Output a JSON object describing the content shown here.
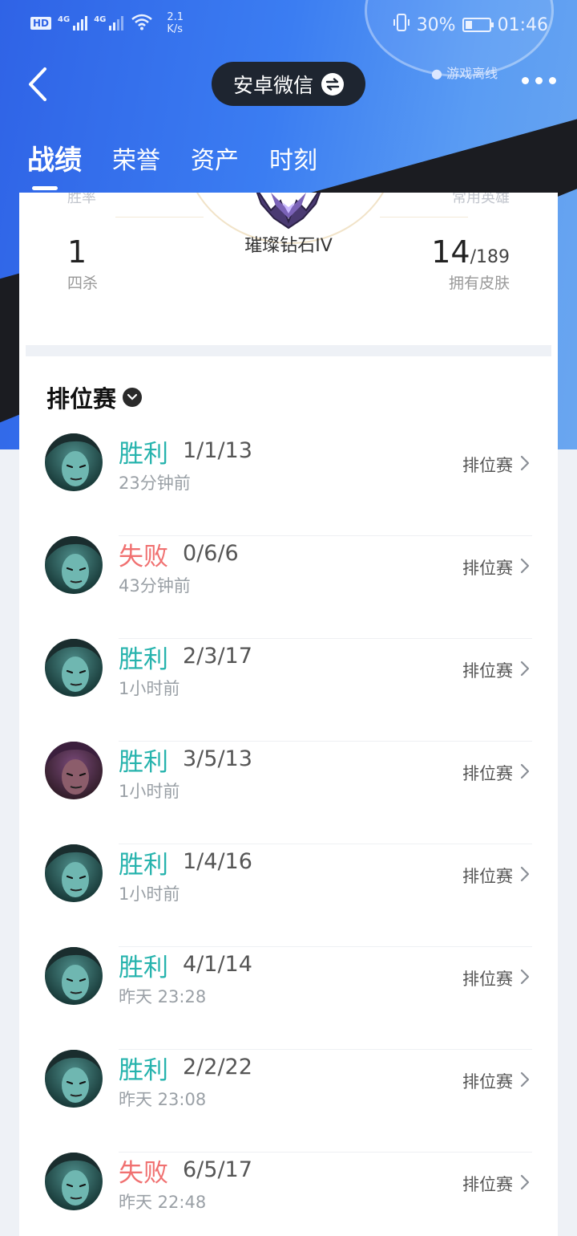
{
  "status_bar": {
    "hd": "HD",
    "net1": "4G",
    "net2": "4G",
    "speed_value": "2.1",
    "speed_unit": "K/s",
    "battery": "30%",
    "battery_level": 0.3,
    "time": "01:46"
  },
  "nav": {
    "account_label": "安卓微信",
    "game_status": "游戏离线"
  },
  "tabs": [
    {
      "label": "战绩",
      "active": true
    },
    {
      "label": "荣誉",
      "active": false
    },
    {
      "label": "资产",
      "active": false
    },
    {
      "label": "时刻",
      "active": false
    }
  ],
  "stats": {
    "rank_name": "璀璨钻石IV",
    "quadra_kills_value": "1",
    "quadra_kills_label": "四杀",
    "skins_owned": "14",
    "skins_total": "/189",
    "skins_label": "拥有皮肤",
    "cut_label_left": "胜率",
    "cut_label_right": "常用英雄"
  },
  "section": {
    "title": "排位赛"
  },
  "matches": [
    {
      "result": "胜利",
      "outcome": "win",
      "kda": "1/1/13",
      "time": "23分钟前",
      "mode": "排位赛",
      "avatar": "teal"
    },
    {
      "result": "失败",
      "outcome": "loss",
      "kda": "0/6/6",
      "time": "43分钟前",
      "mode": "排位赛",
      "avatar": "teal"
    },
    {
      "result": "胜利",
      "outcome": "win",
      "kda": "2/3/17",
      "time": "1小时前",
      "mode": "排位赛",
      "avatar": "teal"
    },
    {
      "result": "胜利",
      "outcome": "win",
      "kda": "3/5/13",
      "time": "1小时前",
      "mode": "排位赛",
      "avatar": "purple"
    },
    {
      "result": "胜利",
      "outcome": "win",
      "kda": "1/4/16",
      "time": "1小时前",
      "mode": "排位赛",
      "avatar": "teal"
    },
    {
      "result": "胜利",
      "outcome": "win",
      "kda": "4/1/14",
      "time": "昨天 23:28",
      "mode": "排位赛",
      "avatar": "teal"
    },
    {
      "result": "胜利",
      "outcome": "win",
      "kda": "2/2/22",
      "time": "昨天 23:08",
      "mode": "排位赛",
      "avatar": "teal"
    },
    {
      "result": "失败",
      "outcome": "loss",
      "kda": "6/5/17",
      "time": "昨天 22:48",
      "mode": "排位赛",
      "avatar": "teal"
    }
  ],
  "colors": {
    "win": "#26b3ad",
    "loss": "#f07070",
    "header_blue": "#2f63e6"
  }
}
